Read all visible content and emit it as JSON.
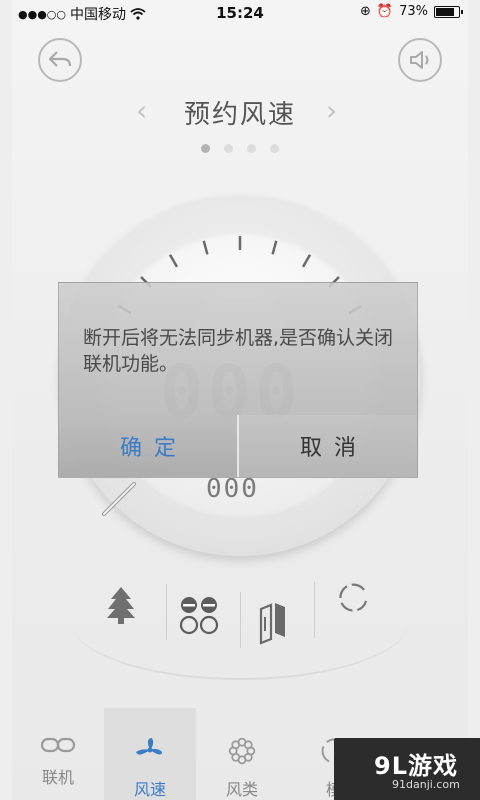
{
  "status_bar": {
    "carrier": "中国移动",
    "time": "15:24",
    "battery": "73%",
    "battery_level": 0.73
  },
  "header": {
    "title": "预约风速",
    "prev": "‹",
    "next": "›",
    "page_count": 4,
    "active_page": 1
  },
  "dial": {
    "digits": "000",
    "sub_digits": "000"
  },
  "dialog": {
    "message": "断开后将无法同步机器,是否确认关闭联机功能。",
    "confirm": "确定",
    "cancel": "取消"
  },
  "bottom_nav": {
    "items": [
      {
        "label": "联机",
        "icon": "link-icon"
      },
      {
        "label": "风速",
        "icon": "fan-icon",
        "active": true
      },
      {
        "label": "风类",
        "icon": "flower-icon"
      },
      {
        "label": "模",
        "icon": "mode-icon"
      }
    ]
  },
  "watermark": {
    "main": "9L游戏",
    "sub": "91danji.com"
  },
  "colors": {
    "accent": "#3b7cc7"
  }
}
